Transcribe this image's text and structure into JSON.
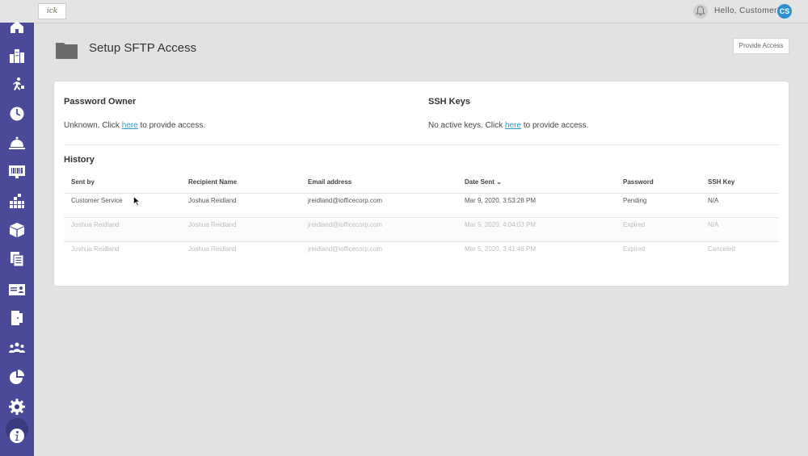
{
  "header": {
    "logo_text": "ick",
    "greeting": "Hello, Customer!",
    "avatar_initials": "CS"
  },
  "sidebar": {
    "items": [
      {
        "name": "home-icon"
      },
      {
        "name": "buildings-icon"
      },
      {
        "name": "move-icon"
      },
      {
        "name": "clock-icon"
      },
      {
        "name": "service-bell-icon"
      },
      {
        "name": "barcode-monitor-icon"
      },
      {
        "name": "floor-stats-icon"
      },
      {
        "name": "package-icon"
      },
      {
        "name": "documents-icon"
      },
      {
        "name": "id-card-icon"
      },
      {
        "name": "door-icon"
      },
      {
        "name": "people-icon"
      },
      {
        "name": "pie-chart-icon"
      },
      {
        "name": "gear-icon"
      },
      {
        "name": "info-icon"
      }
    ],
    "active_index": 13,
    "color": "#4a4a98"
  },
  "page": {
    "title": "Setup SFTP Access",
    "provide_button": "Provide Access"
  },
  "password_owner": {
    "heading": "Password Owner",
    "text_before": "Unknown. Click ",
    "link": "here",
    "text_after": " to provide access."
  },
  "ssh_keys": {
    "heading": "SSH Keys",
    "text_before": "No active keys. Click ",
    "link": "here",
    "text_after": " to provide access."
  },
  "history": {
    "heading": "History",
    "columns": [
      "Sent by",
      "Recipient Name",
      "Email address",
      "Date Sent",
      "Password",
      "SSH Key"
    ],
    "sort_indicator": "⌄",
    "rows": [
      {
        "sent_by": "Customer Service",
        "recipient": "Joshua Reidland",
        "email": "jreidland@iofficecorp.com",
        "date": "Mar 9, 2020, 3:53:28 PM",
        "password": "Pending",
        "ssh_key": "N/A"
      },
      {
        "sent_by": "Joshua Reidland",
        "recipient": "Joshua Reidland",
        "email": "jreidland@iofficecorp.com",
        "date": "Mar 5, 2020, 4:04:03 PM",
        "password": "Expired",
        "ssh_key": "N/A"
      },
      {
        "sent_by": "Joshua Reidland",
        "recipient": "Joshua Reidland",
        "email": "jreidland@iofficecorp.com",
        "date": "Mar 5, 2020, 3:41:46 PM",
        "password": "Expired",
        "ssh_key": "Canceled"
      }
    ]
  }
}
